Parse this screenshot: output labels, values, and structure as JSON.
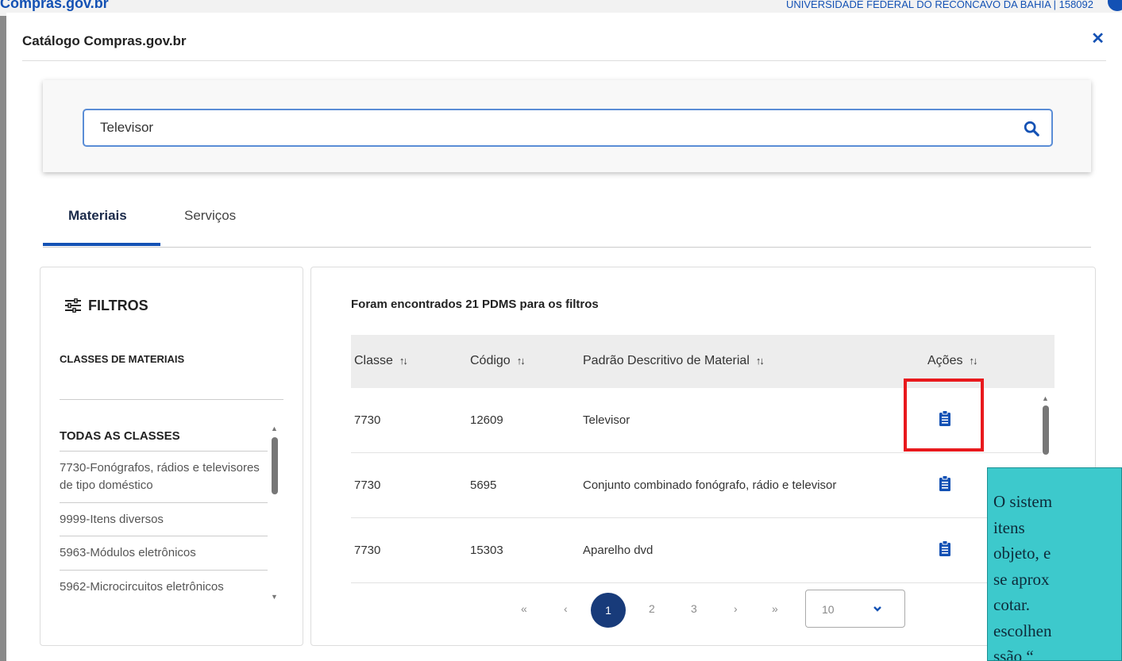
{
  "background": {
    "header_org": "UNIVERSIDADE FEDERAL DO RECÔNCAVO DA BAHIA | 158092",
    "logo_text": "Compras.gov.br"
  },
  "modal": {
    "title": "Catálogo Compras.gov.br",
    "close_icon": "close-x"
  },
  "search": {
    "value": "Televisor",
    "icon": "search-icon"
  },
  "tabs": [
    {
      "label": "Materiais",
      "active": true
    },
    {
      "label": "Serviços",
      "active": false
    }
  ],
  "filters": {
    "title": "FILTROS",
    "classes_label": "CLASSES DE MATERIAIS",
    "all_classes": "TODAS AS CLASSES",
    "items": [
      "7730-Fonógrafos, rádios e televisores de tipo doméstico",
      "9999-Itens diversos",
      "5963-Módulos eletrônicos",
      "5962-Microcircuitos eletrônicos"
    ]
  },
  "results": {
    "count_text": "Foram encontrados 21 PDMS para os filtros",
    "columns": [
      "Classe",
      "Código",
      "Padrão Descritivo de Material",
      "Ações"
    ],
    "sort_icon": "↑↓",
    "rows": [
      {
        "classe": "7730",
        "codigo": "12609",
        "descricao": "Televisor",
        "action_icon": "clipboard-list-icon"
      },
      {
        "classe": "7730",
        "codigo": "5695",
        "descricao": "Conjunto combinado fonógrafo, rádio e televisor",
        "action_icon": "clipboard-list-icon"
      },
      {
        "classe": "7730",
        "codigo": "15303",
        "descricao": "Aparelho dvd",
        "action_icon": "clipboard-list-icon"
      }
    ]
  },
  "pagination": {
    "first": "«",
    "prev": "‹",
    "pages": [
      "1",
      "2",
      "3"
    ],
    "current": "1",
    "next": "›",
    "last": "»",
    "per_page": "10"
  },
  "annotation": {
    "highlight_color": "#e8191d",
    "callout_color": "#3dc9cc",
    "callout_text": "O sistem\nitens\nobjeto, e\nse aprox\ncotar.\nescolhen\nssão “"
  },
  "colors": {
    "primary": "#1351b4",
    "page_active": "#183b7a"
  }
}
